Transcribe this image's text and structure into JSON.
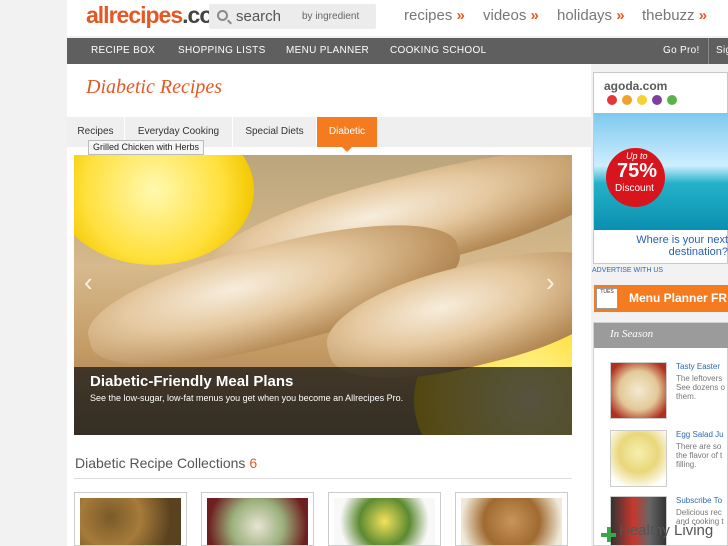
{
  "header": {
    "logo_text": "allrecipes",
    "logo_suffix": ".com",
    "search_label": "search",
    "by_ingredient": "by ingredient",
    "nav": [
      {
        "label": "recipes",
        "arrow": "»"
      },
      {
        "label": "videos",
        "arrow": "»"
      },
      {
        "label": "holidays",
        "arrow": "»"
      },
      {
        "label": "thebuzz",
        "arrow": "»"
      }
    ]
  },
  "navbar": {
    "items": [
      "RECIPE BOX",
      "SHOPPING LISTS",
      "MENU PLANNER",
      "COOKING SCHOOL"
    ],
    "go_pro": "Go Pro!",
    "sign_in": "Sig"
  },
  "page": {
    "title": "Diabetic Recipes",
    "tabs": [
      "Recipes",
      "Everyday Cooking",
      "Special Diets",
      "Diabetic"
    ],
    "active_tab": "Diabetic"
  },
  "hero": {
    "tooltip": "Grilled Chicken with Herbs",
    "title": "Diabetic-Friendly Meal Plans",
    "subtitle": "See the low-sugar, low-fat menus you get when you become an Allrecipes Pro.",
    "prev": "‹",
    "next": "›"
  },
  "collections": {
    "title": "Diabetic Recipe Collections",
    "count": "6"
  },
  "ad": {
    "brand": "agoda.com",
    "up_to": "Up to",
    "percent": "75%",
    "discount": "Discount",
    "question": "Where is your next destination?",
    "advertise": "ADVERTISE WITH US"
  },
  "menu_planner": {
    "tues": "TUES",
    "text": "Menu Planner FR"
  },
  "in_season": {
    "title": "In Season",
    "items": [
      {
        "title": "Tasty Easter",
        "desc1": "The leftovers",
        "desc2": "See dozens o",
        "desc3": "them."
      },
      {
        "title": "Egg Salad Ju",
        "desc1": "There are so",
        "desc2": "the flavor of t",
        "desc3": "filling."
      },
      {
        "title": "Subscribe To",
        "desc1": "Delicious rec",
        "desc2": "and cooking t",
        "desc3": ""
      }
    ]
  },
  "watermark": "Healthy Living",
  "colors": {
    "brand": "#e45826",
    "tab_active": "#f47b20",
    "navbar": "#5f5f5f",
    "link": "#2f68b3"
  }
}
